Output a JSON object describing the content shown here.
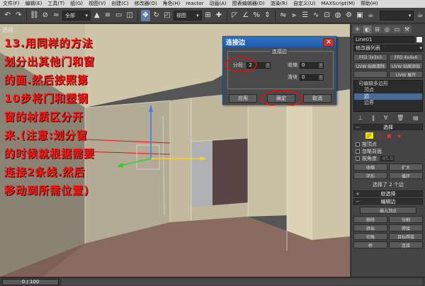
{
  "menu": [
    "文件(F)",
    "编辑(E)",
    "工具(T)",
    "组(G)",
    "视图(V)",
    "创建(C)",
    "修改器(O)",
    "角色(H)",
    "reactor",
    "动画(A)",
    "图表编辑器(D)",
    "渲染(R)",
    "自定义(U)",
    "MAXScript(M)",
    "帮助(H)"
  ],
  "toolbar": {
    "selection_filter": "全部",
    "reference_coord": "视图"
  },
  "viewport": {
    "label": "透视"
  },
  "instruction": {
    "text": "13.用同样的方法划分出其他门和窗的面.然后按照第10步将门和塑钢窗的材质区分开来.(注意:划分窗的时候就根据需要连接2条线.然后移动到所需位置)"
  },
  "dialog": {
    "title": "连接边",
    "close_icon": "close-icon",
    "group_title": "连接边",
    "segments_label": "分段:",
    "segments_value": "2",
    "pinch_label": "收缩",
    "pinch_value": "0",
    "slide_label": "滑块",
    "slide_value": "0",
    "apply_label": "应用",
    "ok_label": "确定",
    "cancel_label": "取消",
    "annotation_color": "#e01010"
  },
  "command_panel": {
    "object_name": "Line01",
    "modifier_list": "修改器列表",
    "buttons": [
      "FFD 3x3x3",
      "FFD 4x4x4",
      "UVW 贴图清除",
      "UVW 贴图添加",
      "",
      "UVW 展开"
    ],
    "stack": [
      {
        "label": "可编辑多边形",
        "level": 0
      },
      {
        "label": "顶点",
        "level": 1
      },
      {
        "label": "边",
        "level": 1,
        "selected": true
      },
      {
        "label": "边界",
        "level": 1
      }
    ],
    "selection_rollout": "选择",
    "by_vertex": "按顶点",
    "ignore_backfacing": "忽略背面",
    "by_angle": "按角度:",
    "angle_value": "45.0",
    "shrink": "收缩",
    "grow": "扩大",
    "ring": "环形",
    "loop": "循环",
    "selected_count": "选择了 2 个边",
    "soft_selection_rollout": "软选择",
    "edit_edges_rollout": "编辑边",
    "insert_vertex": "插入顶点",
    "remove": "移除",
    "split": "分割",
    "extrude": "挤出",
    "weld": "焊接",
    "chamfer": "切角",
    "target_weld": "目标焊接",
    "bridge": "桥",
    "connect": "连接"
  },
  "timeline": {
    "frame": "0 / 100"
  }
}
